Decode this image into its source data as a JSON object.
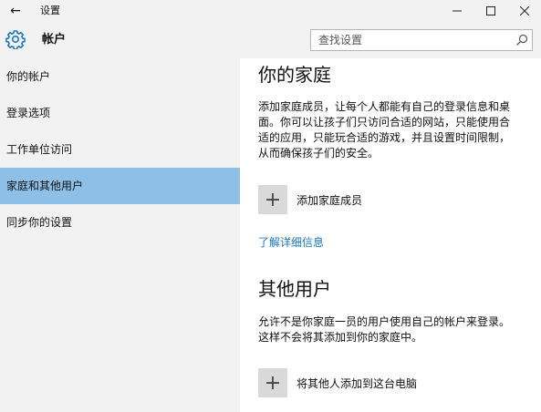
{
  "titlebar": {
    "back_icon": "back-arrow-icon",
    "title": "设置"
  },
  "header": {
    "title": "帐户",
    "icon": "gear-icon"
  },
  "search": {
    "placeholder": "查找设置",
    "icon": "search-icon"
  },
  "sidebar": {
    "items": [
      {
        "label": "你的帐户"
      },
      {
        "label": "登录选项"
      },
      {
        "label": "工作单位访问"
      },
      {
        "label": "家庭和其他用户",
        "selected": true
      },
      {
        "label": "同步你的设置"
      }
    ]
  },
  "main": {
    "family": {
      "title": "你的家庭",
      "description_lines": [
        "添加家庭成员，让每个人都能有自己的登录信息和桌",
        "面。你可以让孩子们只访问合适的网站，只能使用合",
        "适的应用，只能玩合适的游戏，并且设置时间限制，",
        "从而确保孩子们的安全。"
      ],
      "add_label": "添加家庭成员",
      "learn_more": "了解详细信息"
    },
    "others": {
      "title": "其他用户",
      "description_lines": [
        "允许不是你家庭一员的用户使用自己的帐户来登录。",
        "这样不会将其添加到你的家庭中。"
      ],
      "add_label": "将其他人添加到这台电脑"
    }
  },
  "colors": {
    "accent": "#1a78c2",
    "selected_nav": "#8ebfe6",
    "chrome_bg": "#f2f2f2",
    "add_button_bg": "#d9d9d9"
  }
}
